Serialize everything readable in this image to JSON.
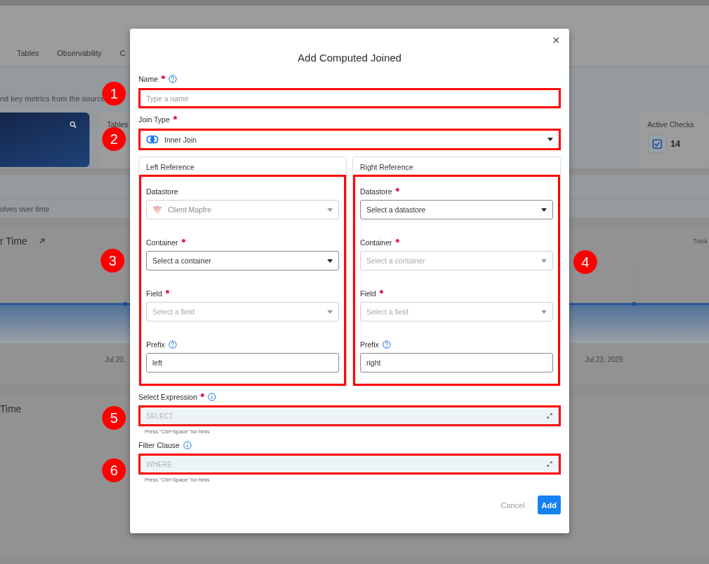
{
  "background": {
    "nav_tabs": [
      "Tables",
      "Observability",
      "C"
    ],
    "subtitle": "nd key metrics from the source",
    "cards": [
      {
        "label": "Tables"
      },
      {
        "label": "Active Checks",
        "value": "14"
      }
    ],
    "section_caption": "olves over time",
    "chart_title": "r Time",
    "chart_aside": "Track",
    "x_labels": [
      "Jul 20,",
      "Jul 23, 2025"
    ],
    "second_title": "Time"
  },
  "modal": {
    "title": "Add Computed Joined",
    "name": {
      "label": "Name",
      "required": true,
      "help": true,
      "placeholder": "Type a name",
      "highlighted": true
    },
    "join_type": {
      "label": "Join Type",
      "required": true,
      "value": "Inner Join",
      "highlighted": true
    },
    "references": [
      {
        "title": "Left Reference",
        "highlighted": true,
        "fields": [
          {
            "kind": "select",
            "label": "Datastore",
            "required": false,
            "disabled": true,
            "value": "Client Mapfre",
            "logo": true
          },
          {
            "kind": "select",
            "label": "Container",
            "required": true,
            "disabled": false,
            "placeholder": "Select a container"
          },
          {
            "kind": "select",
            "label": "Field",
            "required": true,
            "disabled": true,
            "placeholder": "Select a field"
          },
          {
            "kind": "input",
            "label": "Prefix",
            "help": true,
            "value": "left"
          }
        ]
      },
      {
        "title": "Right Reference",
        "highlighted": true,
        "fields": [
          {
            "kind": "select",
            "label": "Datastore",
            "required": true,
            "disabled": false,
            "placeholder": "Select a datastore"
          },
          {
            "kind": "select",
            "label": "Container",
            "required": true,
            "disabled": true,
            "placeholder": "Select a container"
          },
          {
            "kind": "select",
            "label": "Field",
            "required": true,
            "disabled": true,
            "placeholder": "Select a field"
          },
          {
            "kind": "input",
            "label": "Prefix",
            "help": true,
            "value": "right"
          }
        ]
      }
    ],
    "expressions": [
      {
        "label": "Select Expression",
        "required": true,
        "placeholder": "SELECT",
        "hint": "Press \"Ctrl+Space\" for hints",
        "highlighted": true
      },
      {
        "label": "Filter Clause",
        "required": false,
        "placeholder": "WHERE",
        "hint": "Press \"Ctrl+Space\" for hints",
        "highlighted": true
      }
    ],
    "buttons": [
      {
        "label": "Cancel",
        "kind": "text"
      },
      {
        "label": "Add",
        "kind": "primary"
      }
    ]
  },
  "annotations": [
    {
      "number": "1"
    },
    {
      "number": "2"
    },
    {
      "number": "3"
    },
    {
      "number": "4"
    },
    {
      "number": "5"
    },
    {
      "number": "6"
    }
  ]
}
